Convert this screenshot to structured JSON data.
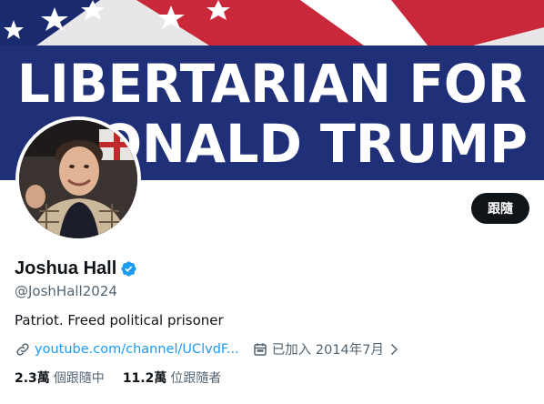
{
  "banner": {
    "line1": "LIBERTARIAN FOR",
    "line2": "DONALD TRUMP"
  },
  "profile": {
    "display_name": "Joshua Hall",
    "handle": "@JoshHall2024",
    "bio": "Patriot. Freed political prisoner",
    "link_text": "youtube.com/channel/UClvdF...",
    "joined_text": "已加入 2014年7月",
    "verified": true
  },
  "actions": {
    "follow_label": "跟隨"
  },
  "stats": {
    "following_count": "2.3萬",
    "following_label": "個跟隨中",
    "followers_count": "11.2萬",
    "followers_label": "位跟隨者"
  },
  "colors": {
    "accent": "#1d9bf0",
    "text": "#0f1419",
    "secondary": "#536471",
    "banner_blue": "#1f2f78",
    "banner_red": "#c8283a"
  },
  "icons": [
    "verified-badge-icon",
    "link-icon",
    "calendar-icon",
    "chevron-right-icon"
  ]
}
